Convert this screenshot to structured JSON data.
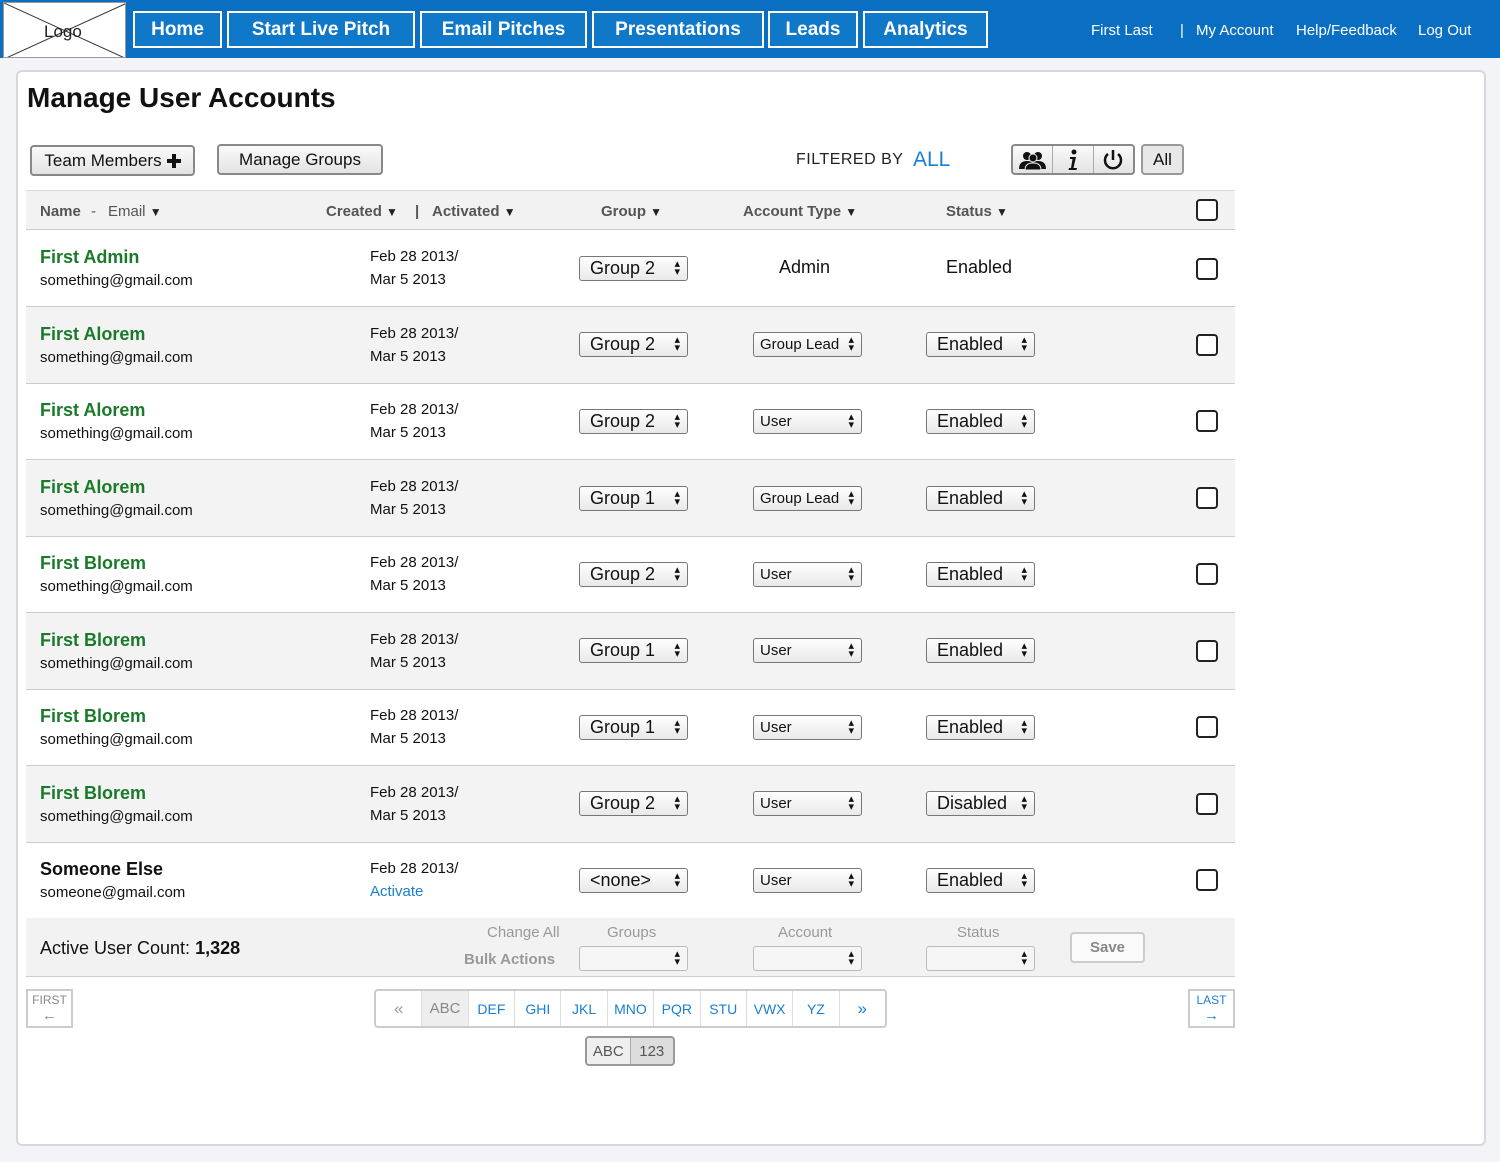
{
  "logo": {
    "label": "Logo"
  },
  "nav": {
    "items": [
      "Home",
      "Start Live Pitch",
      "Email Pitches",
      "Presentations",
      "Leads",
      "Analytics"
    ]
  },
  "account": {
    "user_name": "First Last",
    "separator": "|",
    "my_account": "My Account",
    "help": "Help/Feedback",
    "logout": "Log Out"
  },
  "page": {
    "title": "Manage User Accounts"
  },
  "toolbar": {
    "team_members_label": "Team Members",
    "team_members_icon": "plus-icon",
    "manage_groups_label": "Manage Groups",
    "filtered_by_label": "FILTERED BY",
    "filtered_by_value": "ALL",
    "filter_icons": [
      "users-icon",
      "info-icon",
      "power-icon"
    ],
    "all_label": "All"
  },
  "table": {
    "headers": {
      "name": "Name",
      "dash": "-",
      "email": "Email",
      "created": "Created",
      "sep": "|",
      "activated": "Activated",
      "group": "Group",
      "account_type": "Account Type",
      "status": "Status"
    },
    "rows": [
      {
        "name": "First Admin",
        "email": "something@gmail.com",
        "created": "Feb 28 2013/",
        "activated": "Mar 5 2013",
        "group": "Group 2",
        "account_type": "Admin",
        "status": "Enabled"
      },
      {
        "name": "First Alorem",
        "email": "something@gmail.com",
        "created": "Feb 28 2013/",
        "activated": "Mar 5 2013",
        "group": "Group 2",
        "account_type": "Group Lead",
        "status": "Enabled"
      },
      {
        "name": "First Alorem",
        "email": "something@gmail.com",
        "created": "Feb 28 2013/",
        "activated": "Mar 5 2013",
        "group": "Group 2",
        "account_type": "User",
        "status": "Enabled"
      },
      {
        "name": "First Alorem",
        "email": "something@gmail.com",
        "created": "Feb 28 2013/",
        "activated": "Mar 5 2013",
        "group": "Group 1",
        "account_type": "Group Lead",
        "status": "Enabled"
      },
      {
        "name": "First Blorem",
        "email": "something@gmail.com",
        "created": "Feb 28 2013/",
        "activated": "Mar 5 2013",
        "group": "Group 2",
        "account_type": "User",
        "status": "Enabled"
      },
      {
        "name": "First Blorem",
        "email": "something@gmail.com",
        "created": "Feb 28 2013/",
        "activated": "Mar 5 2013",
        "group": "Group 1",
        "account_type": "User",
        "status": "Enabled"
      },
      {
        "name": "First Blorem",
        "email": "something@gmail.com",
        "created": "Feb 28 2013/",
        "activated": "Mar 5 2013",
        "group": "Group 1",
        "account_type": "User",
        "status": "Enabled"
      },
      {
        "name": "First Blorem",
        "email": "something@gmail.com",
        "created": "Feb 28 2013/",
        "activated": "Mar 5 2013",
        "group": "Group 2",
        "account_type": "User",
        "status": "Disabled"
      },
      {
        "name": "Someone Else",
        "email": "someone@gmail.com",
        "created": "Feb 28 2013/",
        "activated": "Activate",
        "group": "<none>",
        "account_type": "User",
        "status": "Enabled"
      }
    ]
  },
  "bulk": {
    "active_user_label": "Active User Count:",
    "active_user_count": "1,328",
    "change_all": "Change All",
    "bulk_actions": "Bulk Actions",
    "groups": "Groups",
    "account": "Account",
    "status": "Status",
    "save": "Save"
  },
  "pagination": {
    "first": "FIRST",
    "first_arrow": "←",
    "last": "LAST",
    "last_arrow": "→",
    "prev": "«",
    "next": "»",
    "pages": [
      "ABC",
      "DEF",
      "GHI",
      "JKL",
      "MNO",
      "PQR",
      "STU",
      "VWX",
      "YZ"
    ],
    "active_page": "ABC",
    "toggle": [
      "ABC",
      "123"
    ]
  },
  "colors": {
    "nav_bg": "#0a6fc2",
    "name_green": "#1a7a2a",
    "link_blue": "#1a7fd0"
  }
}
